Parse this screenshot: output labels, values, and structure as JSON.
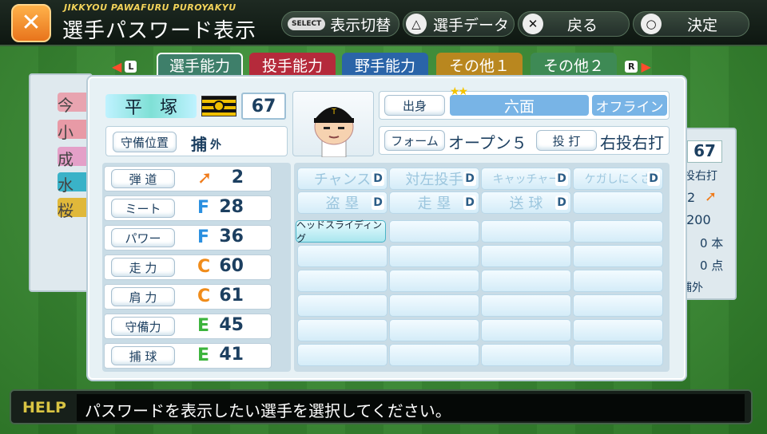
{
  "header": {
    "subtitle": "JIKKYOU PAWAFURU PUROYAKYU",
    "title": "選手パスワード表示",
    "logo_icon": "bat-ball-icon",
    "hints": [
      {
        "button": "SELECT",
        "label": "表示切替"
      },
      {
        "button": "△",
        "label": "選手データ"
      },
      {
        "button": "✕",
        "label": "戻る"
      },
      {
        "button": "○",
        "label": "決定"
      }
    ]
  },
  "tabs": {
    "left_button": "L",
    "right_button": "R",
    "items": [
      {
        "label": "選手能力",
        "color": "#3e7f6a",
        "active": true
      },
      {
        "label": "投手能力",
        "color": "#b52a3b"
      },
      {
        "label": "野手能力",
        "color": "#2a64a8"
      },
      {
        "label": "その他１",
        "color": "#b9871f"
      },
      {
        "label": "その他２",
        "color": "#3e8a55"
      }
    ]
  },
  "player": {
    "name": "平　塚",
    "team_logo": "tigers-logo",
    "overall": "67",
    "position_label": "守備位置",
    "position_main": "捕",
    "position_sub": "外",
    "origin_label": "出身",
    "origin_stars": "★★",
    "origin_value": "六面",
    "origin_mode": "オフライン",
    "form_label": "フォーム",
    "form_value": "オープン５",
    "throwbat_label": "投 打",
    "throwbat_value": "右投右打"
  },
  "abilities": [
    {
      "label": "弾 道",
      "grade": "arrow",
      "grade_color": "#f07b1a",
      "value": "2"
    },
    {
      "label": "ミート",
      "grade": "F",
      "grade_color": "#2a8fe0",
      "value": "28"
    },
    {
      "label": "パワー",
      "grade": "F",
      "grade_color": "#2a8fe0",
      "value": "36"
    },
    {
      "label": "走 力",
      "grade": "C",
      "grade_color": "#f08c1a",
      "value": "60"
    },
    {
      "label": "肩 力",
      "grade": "C",
      "grade_color": "#f08c1a",
      "value": "61"
    },
    {
      "label": "守備力",
      "grade": "E",
      "grade_color": "#3cb43c",
      "value": "45"
    },
    {
      "label": "捕 球",
      "grade": "E",
      "grade_color": "#3cb43c",
      "value": "41"
    }
  ],
  "special_row1": [
    {
      "label": "チャンス",
      "grade": "D"
    },
    {
      "label": "対左投手",
      "grade": "D"
    },
    {
      "label": "キャッチャー",
      "grade": "D"
    },
    {
      "label": "ケガしにくさ",
      "grade": "D"
    }
  ],
  "special_row2": [
    {
      "label": "盗 塁",
      "grade": "D"
    },
    {
      "label": "走 塁",
      "grade": "D"
    },
    {
      "label": "送 球",
      "grade": "D"
    }
  ],
  "special_skills": [
    "ヘッドスライディング"
  ],
  "background_panel": {
    "left_chars": [
      "今",
      "小",
      "成",
      "水",
      "桜"
    ],
    "overall": "67",
    "throwbat": "投右打",
    "trajectory": "2",
    "avg": ".200",
    "hr": "0 本",
    "rbi": "0 点",
    "pos": "捕外"
  },
  "help": {
    "label": "HELP",
    "text": "パスワードを表示したい選手を選択してください。"
  }
}
